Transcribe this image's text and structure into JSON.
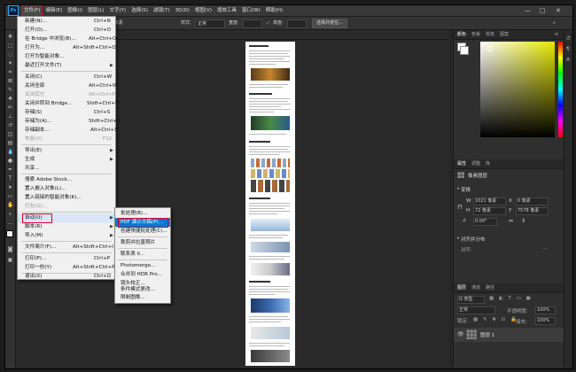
{
  "menubar": {
    "logo": "Ps",
    "items": [
      "文件(F)",
      "编辑(E)",
      "图像(I)",
      "图层(L)",
      "文字(Y)",
      "选择(S)",
      "滤镜(T)",
      "3D(D)",
      "视图(V)",
      "增效工具",
      "窗口(W)",
      "帮助(H)"
    ]
  },
  "optionsbar": {
    "angle": "0 像素",
    "style_label": "样式:",
    "style_value": "正常",
    "width_label": "宽度:",
    "height_label": "高度:",
    "select_mask_button": "选择并遮住..."
  },
  "file_menu": {
    "items": [
      {
        "label": "新建(N)...",
        "shortcut": "Ctrl+N"
      },
      {
        "label": "打开(O)...",
        "shortcut": "Ctrl+O"
      },
      {
        "label": "在 Bridge 中浏览(B)...",
        "shortcut": "Alt+Ctrl+O"
      },
      {
        "label": "打开为...",
        "shortcut": "Alt+Shift+Ctrl+O"
      },
      {
        "label": "打开为智能对象...",
        "shortcut": ""
      },
      {
        "label": "最近打开文件(T)",
        "shortcut": ""
      },
      {
        "label": "关闭(C)",
        "shortcut": "Ctrl+W"
      },
      {
        "label": "关闭全部",
        "shortcut": "Alt+Ctrl+W"
      },
      {
        "label": "关闭其它",
        "shortcut": "Alt+Ctrl+P"
      },
      {
        "label": "关闭并转到 Bridge...",
        "shortcut": "Shift+Ctrl+W"
      },
      {
        "label": "存储(S)",
        "shortcut": "Ctrl+S"
      },
      {
        "label": "存储为(A)...",
        "shortcut": "Shift+Ctrl+S"
      },
      {
        "label": "存储副本...",
        "shortcut": "Alt+Ctrl+S"
      },
      {
        "label": "恢复(V)",
        "shortcut": "F12"
      },
      {
        "label": "导出(E)",
        "shortcut": ""
      },
      {
        "label": "生成",
        "shortcut": ""
      },
      {
        "label": "共享...",
        "shortcut": ""
      },
      {
        "label": "搜索 Adobe Stock...",
        "shortcut": ""
      },
      {
        "label": "置入嵌入对象(L)...",
        "shortcut": ""
      },
      {
        "label": "置入链接的智能对象(K)...",
        "shortcut": ""
      },
      {
        "label": "打包(G)...",
        "shortcut": ""
      },
      {
        "label": "自动(U)",
        "shortcut": ""
      },
      {
        "label": "脚本(R)",
        "shortcut": ""
      },
      {
        "label": "导入(M)",
        "shortcut": ""
      },
      {
        "label": "文件简介(F)...",
        "shortcut": "Alt+Shift+Ctrl+I"
      },
      {
        "label": "打印(P)...",
        "shortcut": "Ctrl+P"
      },
      {
        "label": "打印一份(Y)",
        "shortcut": "Alt+Shift+Ctrl+P"
      },
      {
        "label": "退出(X)",
        "shortcut": "Ctrl+Q"
      }
    ]
  },
  "automate_submenu": {
    "items": [
      "批处理(B)...",
      "PDF 演示文稿(P)...",
      "创建快捷批处理(C)...",
      "裁剪并拉直照片",
      "联系表 II...",
      "Photomerge...",
      "合并到 HDR Pro...",
      "镜头校正...",
      "条件模式更改...",
      "限制图像..."
    ]
  },
  "right_panel": {
    "color_tabs": [
      "颜色",
      "色板",
      "渐变",
      "图案"
    ],
    "props_tabs": [
      "属性",
      "调整",
      "库"
    ],
    "pixel_layer": "像素图层",
    "transform_label": "变换",
    "w_label": "W",
    "w_value": "1021 像素",
    "x_value": "0 像素",
    "h_label": "H",
    "h_value": "72 像素",
    "y_value": "7578 像素",
    "angle_value": "0.00°",
    "align_label": "对齐并分布",
    "align_sub": "对齐:",
    "layers_tabs": [
      "图层",
      "通道",
      "路径"
    ],
    "kind_label": "Q 类型",
    "blend_mode": "正常",
    "opacity_label": "不透明度:",
    "opacity_value": "100%",
    "lock_label": "锁定:",
    "fill_label": "填充:",
    "fill_value": "100%",
    "layer_name": "图层 1"
  },
  "colors": {
    "accent_red": "#e0002a",
    "menu_bg": "#f0f0f0",
    "highlight_blue": "#0078d7"
  }
}
